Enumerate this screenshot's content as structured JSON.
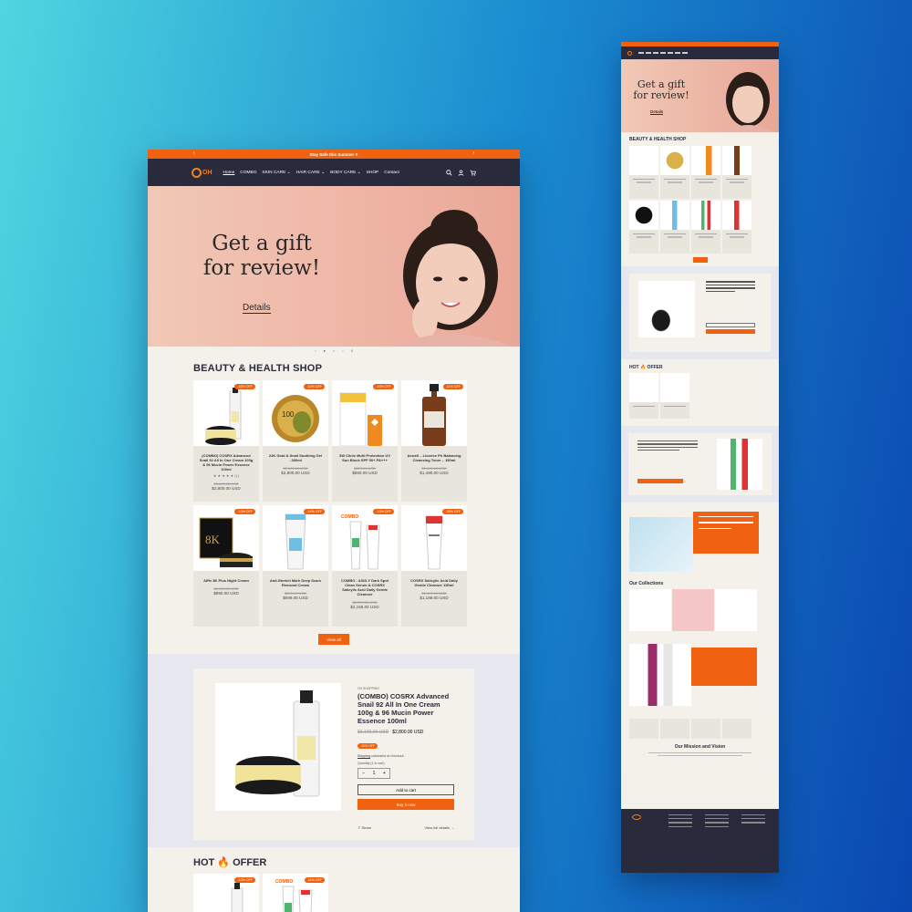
{
  "announcement": {
    "text": "Stay Safe this Summer !!",
    "prev": "‹",
    "next": "›"
  },
  "logo_text": "OH",
  "nav": {
    "items": [
      {
        "label": "Home",
        "active": true
      },
      {
        "label": "COMBO"
      },
      {
        "label": "SKIN CARE ⌄"
      },
      {
        "label": "HAIR CARE ⌄"
      },
      {
        "label": "BODY CARE ⌄"
      },
      {
        "label": "SHOP"
      },
      {
        "label": "Contact"
      }
    ],
    "icons": [
      "search-icon",
      "account-icon",
      "cart-icon"
    ]
  },
  "hero": {
    "title_line1": "Get a gift",
    "title_line2": "for review!",
    "details_label": "Details"
  },
  "slider_controls": {
    "prev": "‹",
    "next": "›",
    "pause": "II"
  },
  "shop": {
    "title": "BEAUTY & HEALTH SHOP",
    "products": [
      {
        "badge": "-10% OFF",
        "name": "(COMBO) COSRX Advanced Snail 92 All In One Cream 100g & 96 Mucin Power Essence 100ml",
        "stars": "★ ★ ★ ★ ★ (1)",
        "old": "$3,100.00 USD",
        "price": "$2,800.00 USD"
      },
      {
        "badge": "-10% OFF",
        "name": "24K Gold & Snail Soothing Gel - 300ml",
        "old": "$3,100.00 USD",
        "price": "$2,800.00 USD"
      },
      {
        "badge": "-10% OFF",
        "name": "3W Clinic Multi Protection UV Sun Block SPF 50+ PA+++",
        "old": "$600.00 USD",
        "price": "$550.00 USD"
      },
      {
        "badge": "-11% OFF",
        "name": "Acwell – Licorice Ph Balancing Cleansing Toner – 150ml",
        "old": "$1,690.00 USD",
        "price": "$1,490.00 USD"
      },
      {
        "badge": "-10% OFF",
        "name": "AiRe 8K Plus Night Cream",
        "old": "$1,100.00 USD",
        "price": "$990.00 USD"
      },
      {
        "badge": "-14% OFF",
        "name": "Anti-Stretch Mark Deep Scars Removal Cream",
        "old": "$690.00 USD",
        "price": "$599.00 USD"
      },
      {
        "badge": "-10% OFF",
        "name": "COMBO : AXIS-Y Dark Spot Clean Serum & COSRX Salicylic Acid Daily Gentle Cleanser",
        "old": "$2,399.00 USD",
        "price": "$2,159.00 USD"
      },
      {
        "badge": "-20% OFF",
        "name": "COSRX Salicylic Acid Daily Gentle Cleanser 150ml",
        "old": "$1,490.00 USD",
        "price": "$1,189.00 USD"
      }
    ],
    "view_all": "View all"
  },
  "featured": {
    "vendor": "OH SHOPPING",
    "title": "(COMBO) COSRX Advanced Snail 92 All In One Cream 100g & 96 Mucin Power Essence 100ml",
    "old": "$3,100.00 USD",
    "price": "$2,800.00 USD",
    "badge": "-10% OFF",
    "shipping_link": "Shipping",
    "shipping_rest": " calculated at checkout.",
    "qty_label": "Quantity (1 in cart)",
    "qty_minus": "−",
    "qty_value": "1",
    "qty_plus": "+",
    "add_to_cart": "Add to cart",
    "buy_now": "Buy it now",
    "share": "Share",
    "view_details": "View full details →"
  },
  "hot": {
    "title_left": "HOT",
    "title_right": "OFFER",
    "badges": [
      "-10% OFF",
      "-11% OFF"
    ]
  },
  "small_mockup": {
    "hero_line1": "Get a gift",
    "hero_line2": "for review!",
    "details": "Details",
    "shop_title": "BEAUTY & HEALTH SHOP",
    "hot_title": "HOT 🔥 OFFER",
    "collections_title": "Our Collections",
    "mission_title": "Our Mission and Vision"
  },
  "colors": {
    "accent": "#f0620f",
    "nav_bg": "#292a3c",
    "page_bg": "#f3f1ea"
  }
}
